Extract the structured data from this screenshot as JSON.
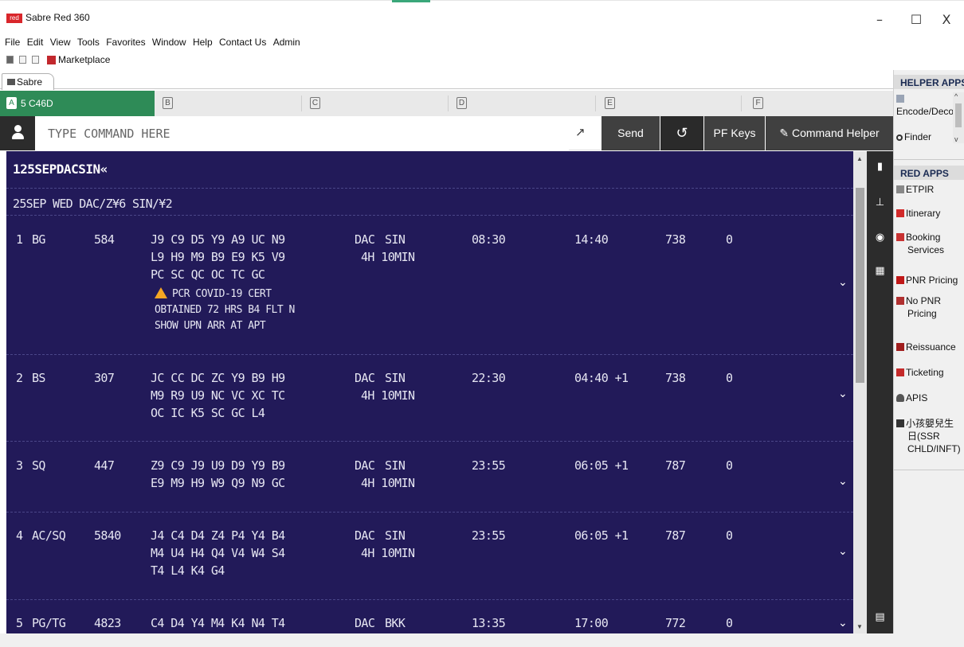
{
  "window": {
    "logo_text": "red",
    "title": "Sabre Red 360",
    "minimize_glyph": "–",
    "maximize_glyph": "☐",
    "close_glyph": "X"
  },
  "menu": [
    "File",
    "Edit",
    "View",
    "Tools",
    "Favorites",
    "Window",
    "Help",
    "Contact Us",
    "Admin"
  ],
  "toolbar": {
    "marketplace_label": "Marketplace"
  },
  "sabre_tab": {
    "label": "Sabre"
  },
  "work_areas": [
    {
      "letter": "A",
      "label": "5 C46D",
      "active": true
    },
    {
      "letter": "B",
      "label": "",
      "active": false
    },
    {
      "letter": "C",
      "label": "",
      "active": false
    },
    {
      "letter": "D",
      "label": "",
      "active": false
    },
    {
      "letter": "E",
      "label": "",
      "active": false
    },
    {
      "letter": "F",
      "label": "",
      "active": false
    }
  ],
  "command_bar": {
    "placeholder": "TYPE COMMAND HERE",
    "send_label": "Send",
    "history_glyph": "↺",
    "pf_keys_label": "PF Keys",
    "command_helper_label": "Command Helper",
    "command_helper_glyph": "✎"
  },
  "screen": {
    "command": "125SEPDACSIN«",
    "header": "25SEP WED DAC/Z¥6 SIN/¥2",
    "flights": [
      {
        "num": "1",
        "airline": "BG",
        "flight": "584",
        "classes": [
          "J9 C9 D5 Y9 A9 UC N9",
          "L9 H9 M9 B9 E9 K5 V9",
          "PC SC QC OC TC GC"
        ],
        "origin": "DAC",
        "dest": "SIN",
        "duration": "4H 10MIN",
        "depart": "08:30",
        "arrive": "14:40",
        "equipment": "738",
        "stops": "0",
        "notice": [
          "PCR COVID-19 CERT",
          "OBTAINED 72 HRS B4 FLT N",
          "SHOW UPN ARR AT APT"
        ]
      },
      {
        "num": "2",
        "airline": "BS",
        "flight": "307",
        "classes": [
          "JC CC DC ZC Y9 B9 H9",
          "M9 R9 U9 NC VC XC TC",
          "OC IC K5 SC GC L4"
        ],
        "origin": "DAC",
        "dest": "SIN",
        "duration": "4H 10MIN",
        "depart": "22:30",
        "arrive": "04:40 +1",
        "equipment": "738",
        "stops": "0"
      },
      {
        "num": "3",
        "airline": "SQ",
        "flight": "447",
        "classes": [
          "Z9 C9 J9 U9 D9 Y9 B9",
          "E9 M9 H9 W9 Q9 N9 GC"
        ],
        "origin": "DAC",
        "dest": "SIN",
        "duration": "4H 10MIN",
        "depart": "23:55",
        "arrive": "06:05 +1",
        "equipment": "787",
        "stops": "0"
      },
      {
        "num": "4",
        "airline": "AC/SQ",
        "flight": "5840",
        "classes": [
          "J4 C4 D4 Z4 P4 Y4 B4",
          "M4 U4 H4 Q4 V4 W4 S4",
          "T4 L4 K4 G4"
        ],
        "origin": "DAC",
        "dest": "SIN",
        "duration": "4H 10MIN",
        "depart": "23:55",
        "arrive": "06:05 +1",
        "equipment": "787",
        "stops": "0"
      },
      {
        "num": "5",
        "airline": "PG/TG",
        "flight": "4823",
        "classes": [
          "C4 D4 Y4 M4 K4 N4 T4"
        ],
        "origin": "DAC",
        "dest": "BKK",
        "duration": "",
        "depart": "13:35",
        "arrive": "17:00",
        "equipment": "772",
        "stops": "0"
      }
    ],
    "chevron_glyph": "⌄"
  },
  "helper": {
    "helper_apps_title": "HELPER APPS",
    "helper_apps": [
      "Encode/Decode",
      "Finder"
    ],
    "red_apps_title": "RED APPS",
    "red_apps": [
      "ETPIR",
      "Itinerary",
      "Booking Services",
      "PNR Pricing",
      "No PNR Pricing",
      "Reissuance",
      "Ticketing",
      "APIS",
      "小孩嬰兒生日(SSR CHLD/INFT)"
    ]
  }
}
